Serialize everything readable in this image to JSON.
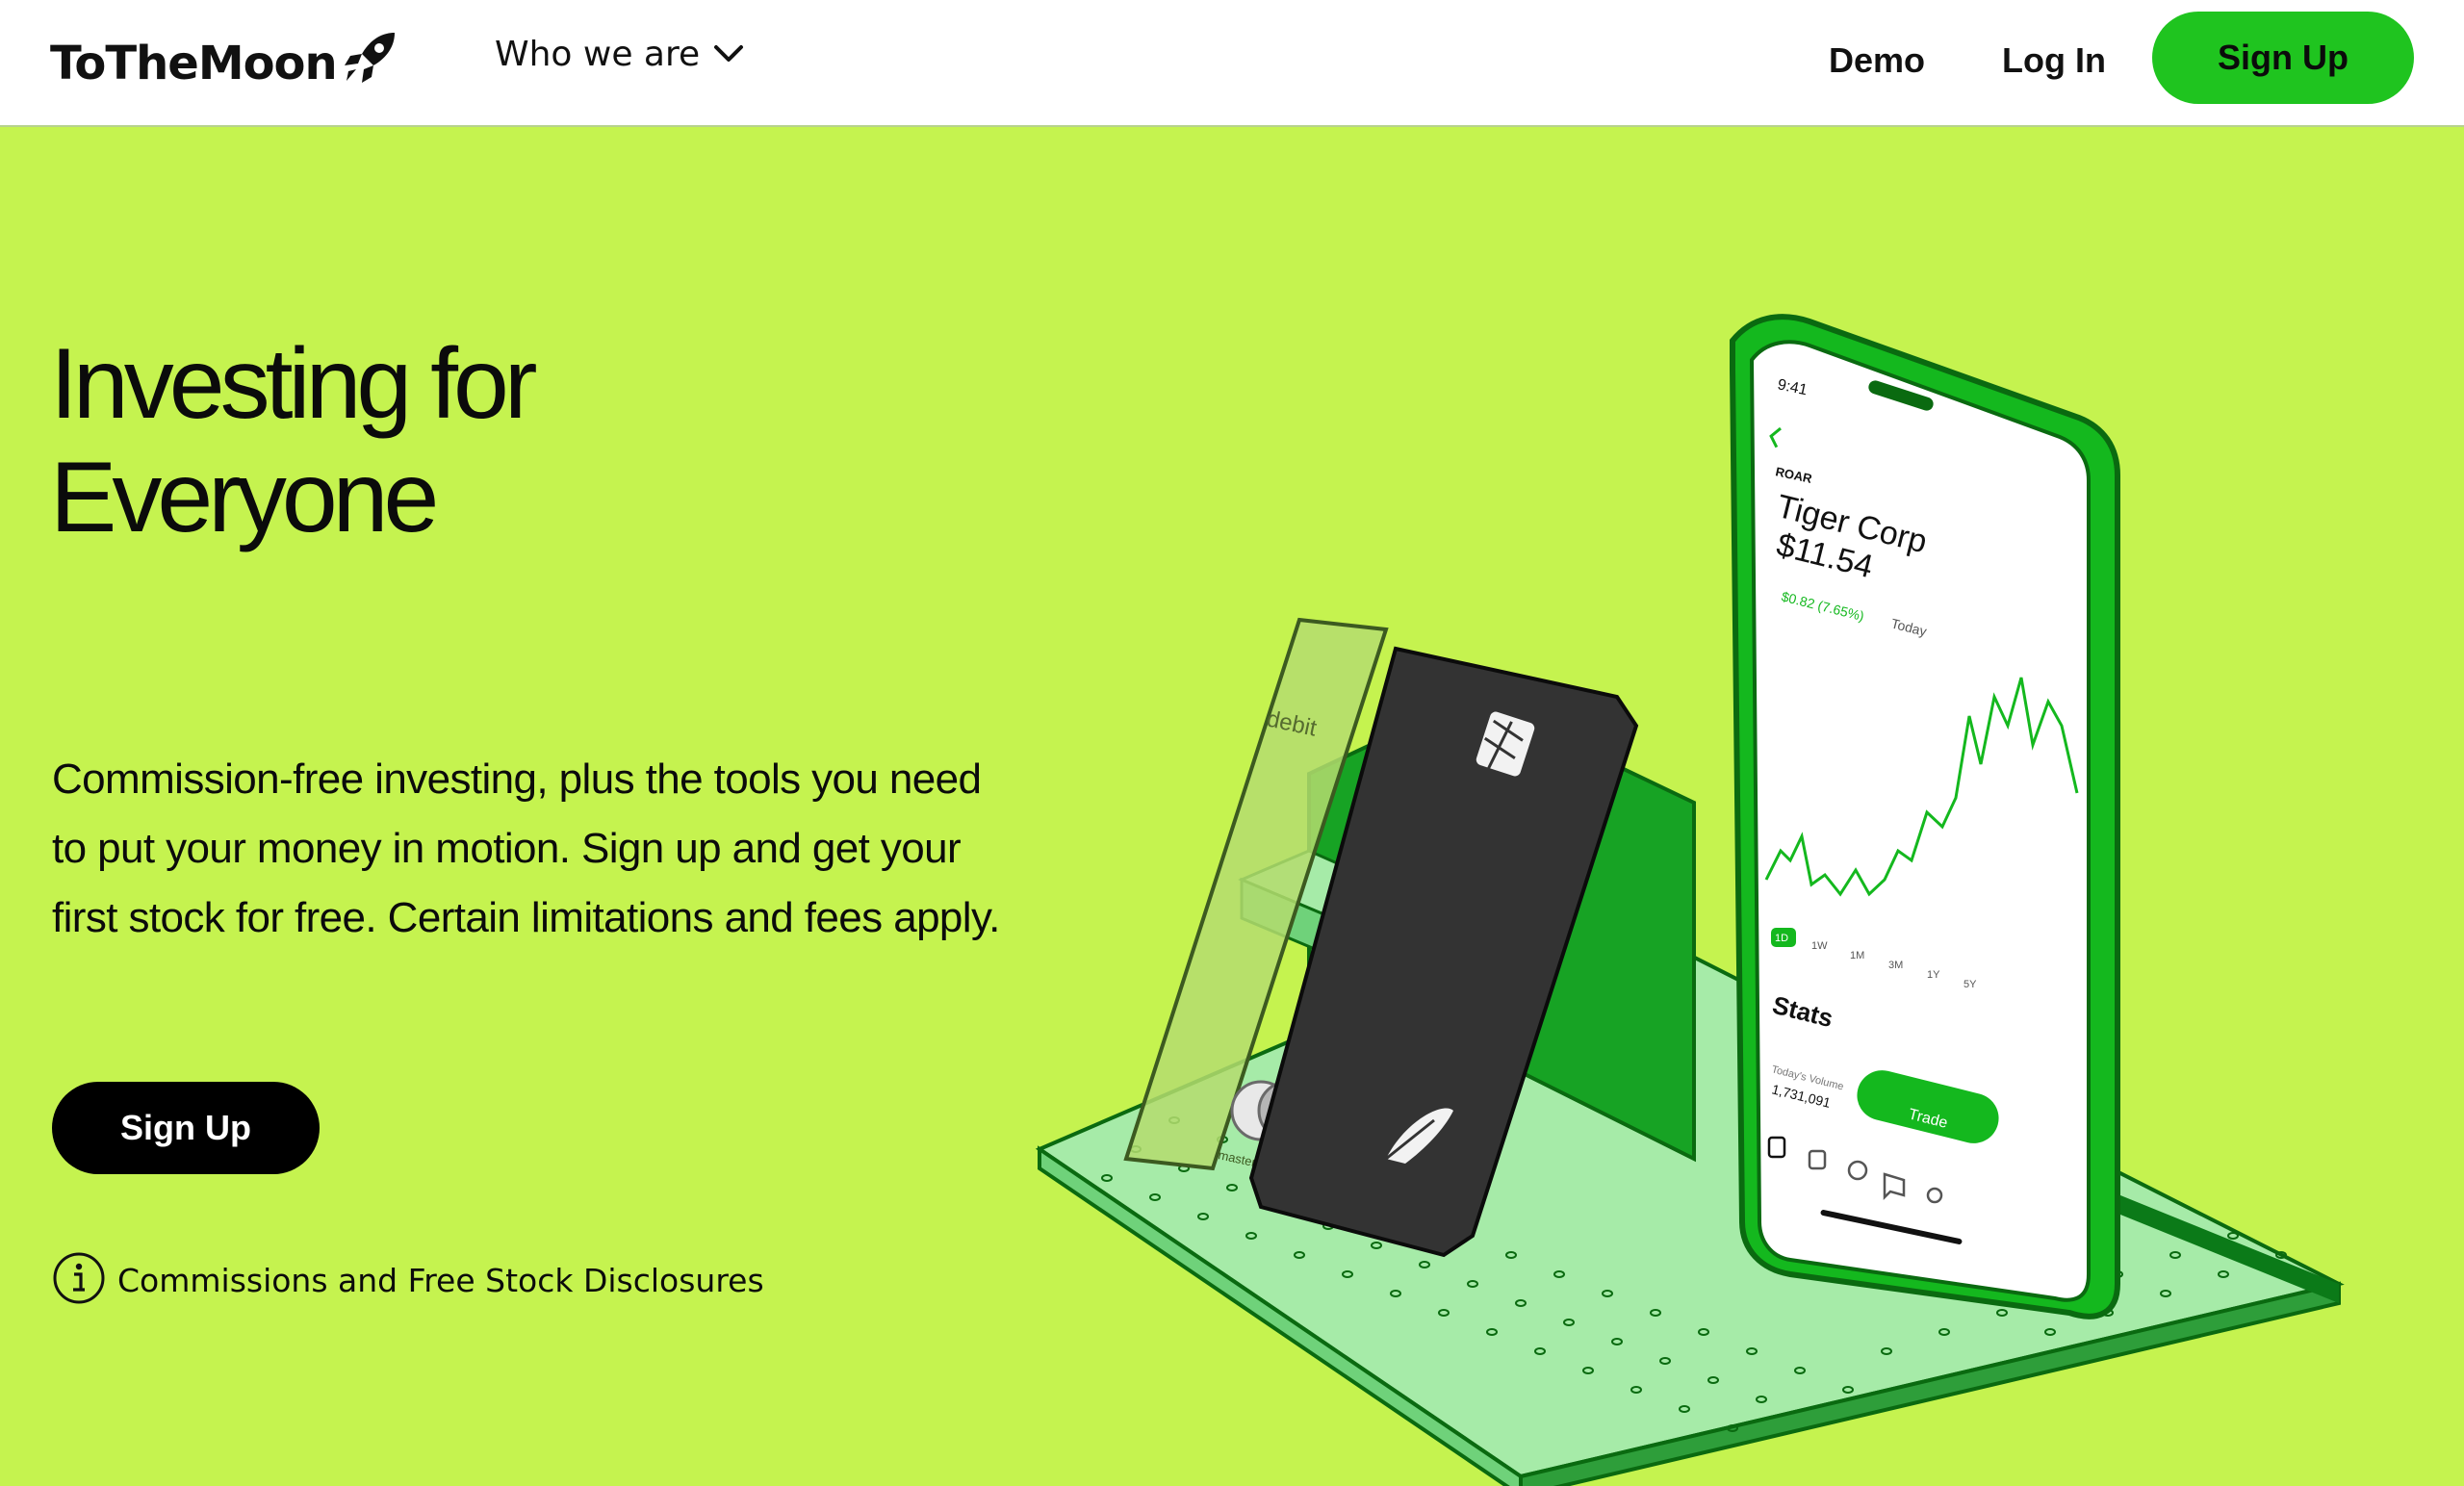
{
  "nav": {
    "brand": "ToTheMoon",
    "menu_label": "Who we are",
    "demo": "Demo",
    "login": "Log In",
    "signup": "Sign Up"
  },
  "hero": {
    "title_line1": "Investing for",
    "title_line2": "Everyone",
    "body": "Commission-free investing, plus the tools you need to put your money in motion. Sign up and get your first stock for free. Certain limitations and fees apply.",
    "signup": "Sign Up",
    "disclosure": "Commissions and Free Stock Disclosures"
  },
  "phone": {
    "time": "9:41",
    "ticker": "ROAR",
    "company": "Tiger Corp",
    "price": "$11.54",
    "change": "$0.82 (7.65%)",
    "change_period": "Today",
    "ranges": [
      "1D",
      "1W",
      "1M",
      "3M",
      "1Y",
      "5Y"
    ],
    "stats_label": "Stats",
    "volume_label": "Today's Volume",
    "volume_value": "1,731,091",
    "trade_button": "Trade"
  },
  "card": {
    "debit_label": "debit",
    "network": "mastercard"
  },
  "colors": {
    "background": "#c5f34f",
    "accent_green": "#1fc41f",
    "dark": "#000000"
  },
  "icons": {
    "brand": "rocket-icon",
    "menu": "chevron-down-icon",
    "disclosure": "info-icon"
  }
}
